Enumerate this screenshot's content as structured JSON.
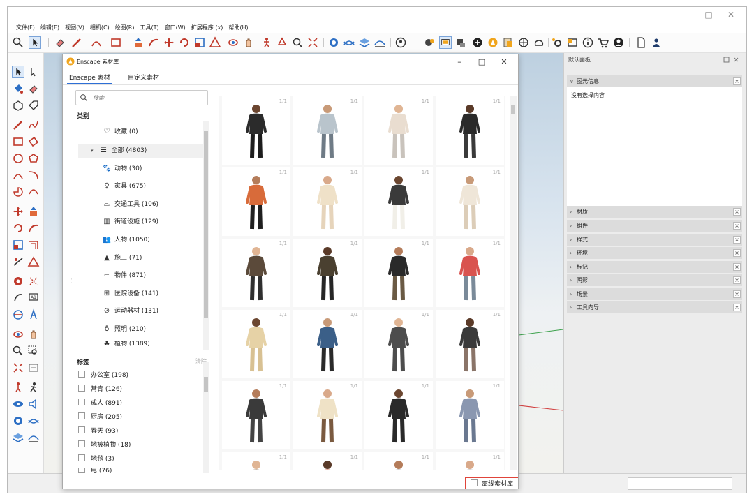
{
  "window": {
    "minimize": "–",
    "maximize": "□",
    "close": "✕"
  },
  "menu": [
    "文件(F)",
    "编辑(E)",
    "视图(V)",
    "相机(C)",
    "绘图(R)",
    "工具(T)",
    "窗口(W)",
    "扩展程序 (x)",
    "帮助(H)"
  ],
  "dialog": {
    "title": "Enscape 素材库",
    "minimize": "–",
    "maximize": "□",
    "close": "✕",
    "tabs": [
      "Enscape 素材",
      "自定义素材"
    ],
    "search_placeholder": "搜索",
    "categories_heading": "类别",
    "categories": [
      {
        "icon": "heart-icon",
        "label": "收藏 (0)"
      },
      {
        "icon": "list-icon",
        "label": "全部 (4803)"
      },
      {
        "icon": "paw-icon",
        "label": "动物 (30)"
      },
      {
        "icon": "lamp-icon",
        "label": "家具 (675)"
      },
      {
        "icon": "car-icon",
        "label": "交通工具 (106)"
      },
      {
        "icon": "street-icon",
        "label": "街道设施 (129)"
      },
      {
        "icon": "people-icon",
        "label": "人物 (1050)"
      },
      {
        "icon": "cone-icon",
        "label": "施工 (71)"
      },
      {
        "icon": "object-icon",
        "label": "物件 (871)"
      },
      {
        "icon": "medical-icon",
        "label": "医院设备 (141)"
      },
      {
        "icon": "sport-icon",
        "label": "运动器材 (131)"
      },
      {
        "icon": "bulb-icon",
        "label": "照明 (210)"
      },
      {
        "icon": "plant-icon",
        "label": "植物 (1389)"
      }
    ],
    "tags_heading": "标签",
    "tags_clear": "清除",
    "tags": [
      "办公室 (198)",
      "常青 (126)",
      "成人 (891)",
      "厨房 (205)",
      "春天 (93)",
      "地被植物 (18)",
      "地毯 (3)",
      "电 (76)"
    ],
    "asset_count_label": "1/1",
    "offline_label": "离线素材库"
  },
  "tray": {
    "title": "默认面板",
    "entity_info": "图元信息",
    "no_selection": "没有选择内容",
    "panels": [
      "材质",
      "组件",
      "样式",
      "环境",
      "标记",
      "阴影",
      "场景",
      "工具向导"
    ]
  },
  "colors": {
    "accent": "#2e6fd6",
    "highlight": "#e0443a"
  }
}
